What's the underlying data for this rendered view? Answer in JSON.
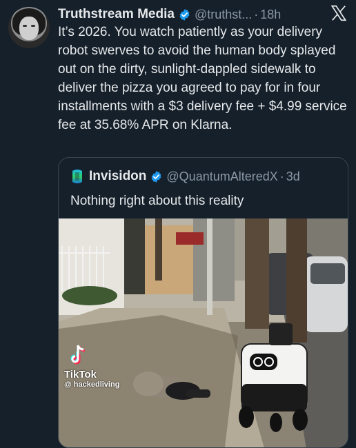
{
  "author": {
    "name": "Truthstream Media",
    "handle": "@truthst...",
    "separator": "·",
    "time": "18h"
  },
  "tweet": {
    "text": "It’s 2026. You watch patiently as your delivery robot swerves to avoid the human body splayed out on the dirty, sunlight-dappled sidewalk to deliver the pizza you agreed to pay for in four installments with a $3 delivery fee + $4.99 service fee at 35.68% APR on Klarna."
  },
  "quoted": {
    "name": "Invisidon",
    "handle": "@QuantumAlteredX",
    "separator": "·",
    "time": "3d",
    "text": "Nothing right about this reality"
  },
  "media_overlay": {
    "brand": "TikTok",
    "handle": "@ hackedliving"
  },
  "icons": {
    "verified": "verified-badge-icon",
    "brand": "x-logo-icon"
  },
  "colors": {
    "background": "#15202b",
    "text": "#e7e9ea",
    "muted": "#8b98a5",
    "verified": "#1d9bf0",
    "border": "#38444d"
  }
}
